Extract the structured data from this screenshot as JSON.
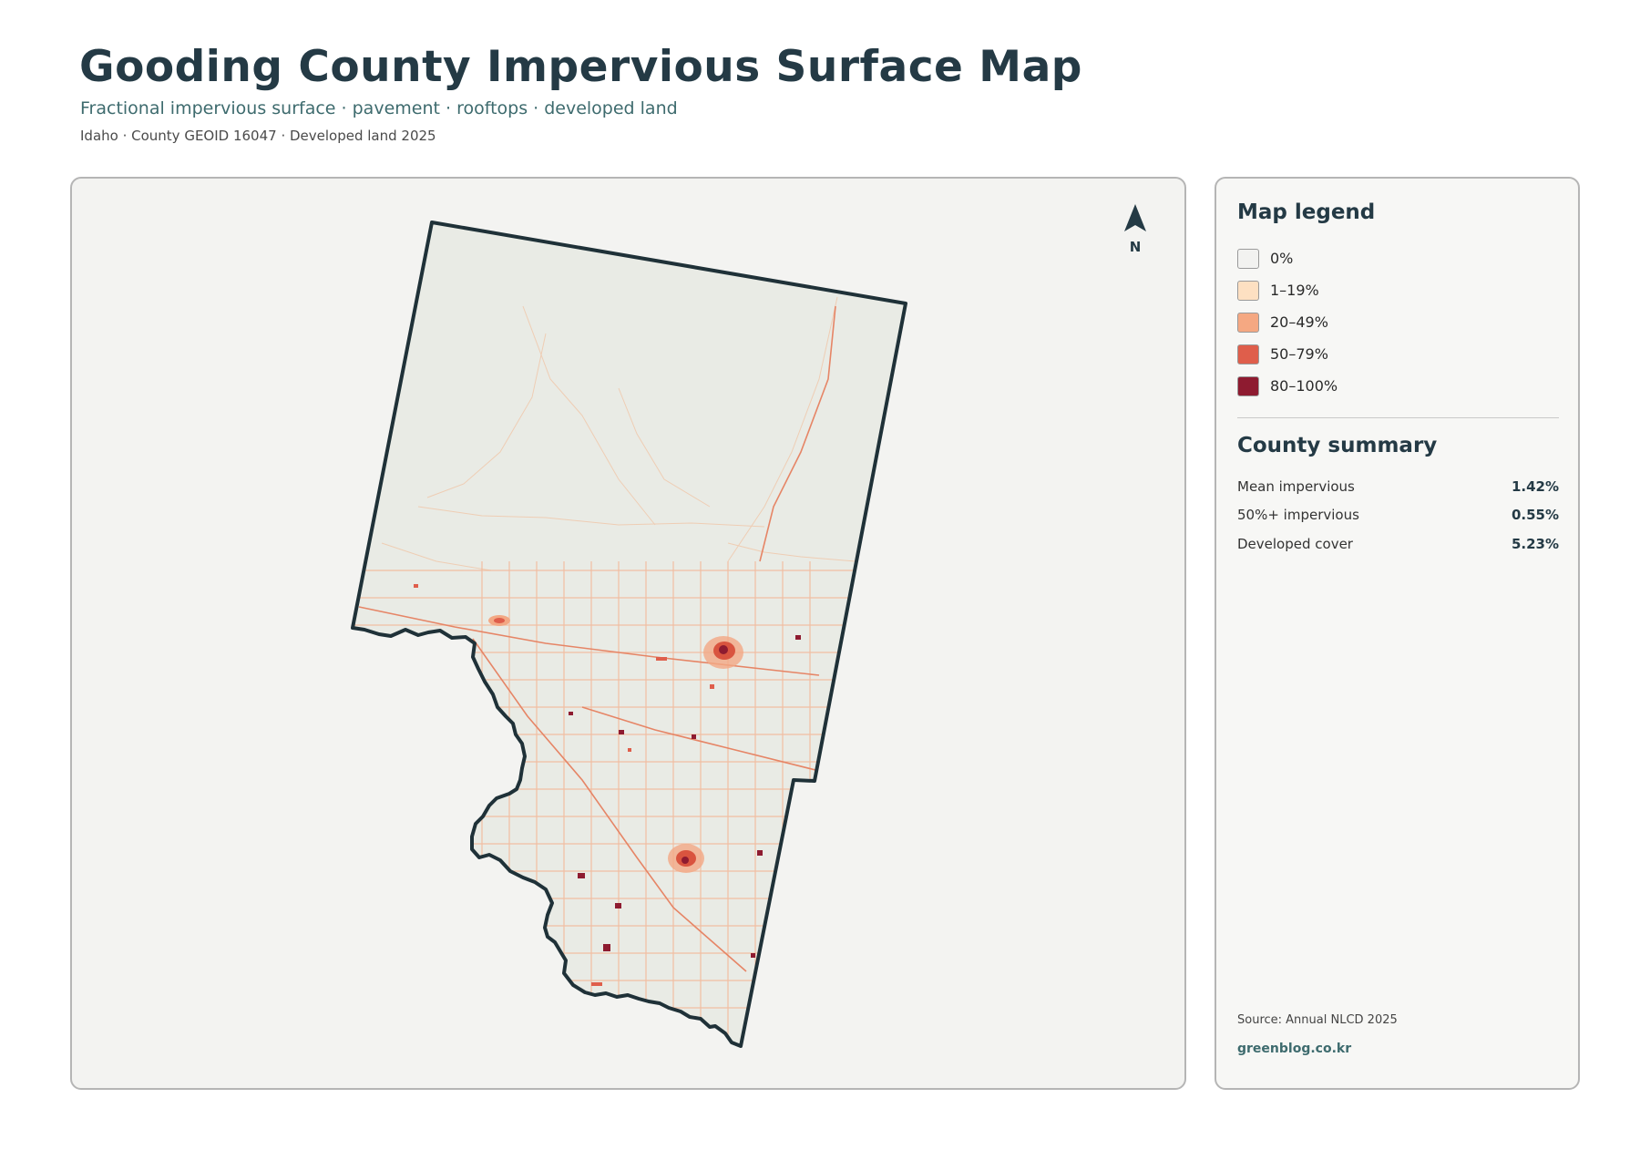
{
  "header": {
    "title": "Gooding County Impervious Surface Map",
    "subtitle": "Fractional impervious surface · pavement · rooftops · developed land",
    "meta": "Idaho · County GEOID 16047 · Developed land 2025"
  },
  "map": {
    "north_label": "N",
    "north_icon": "north-arrow-icon",
    "colors": {
      "background": "#f3f3f1",
      "county_fill": "#e9ebe5",
      "boundary": "#1f3138"
    }
  },
  "legend": {
    "title": "Map legend",
    "items": [
      {
        "label": "0%",
        "color": "#f2f2f0"
      },
      {
        "label": "1–19%",
        "color": "#fde0c2"
      },
      {
        "label": "20–49%",
        "color": "#f5a882"
      },
      {
        "label": "50–79%",
        "color": "#df5e4b"
      },
      {
        "label": "80–100%",
        "color": "#8e1b30"
      }
    ]
  },
  "summary": {
    "title": "County summary",
    "rows": [
      {
        "label": "Mean impervious",
        "value": "1.42%"
      },
      {
        "label": "50%+ impervious",
        "value": "0.55%"
      },
      {
        "label": "Developed cover",
        "value": "5.23%"
      }
    ]
  },
  "footer": {
    "source": "Source: Annual NLCD 2025",
    "site": "greenblog.co.kr"
  }
}
